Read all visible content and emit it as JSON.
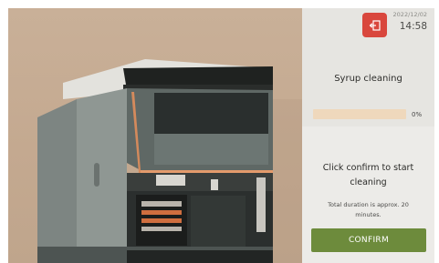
{
  "header": {
    "date": "2022/12/02",
    "time": "14:58",
    "exit_icon": "exit-icon"
  },
  "cleaning": {
    "title": "Syrup cleaning",
    "progress_percent": 0,
    "progress_label": "0%",
    "instruction": "Click confirm to start cleaning",
    "duration_note": "Total duration is approx. 20 minutes."
  },
  "actions": {
    "confirm_label": "CONFIRM"
  },
  "colors": {
    "background_photo": "#c4a990",
    "panel": "#e6e5e1",
    "exit_button": "#d9473d",
    "progress_track": "#efd8bc",
    "confirm_button": "#6d8b3c"
  }
}
